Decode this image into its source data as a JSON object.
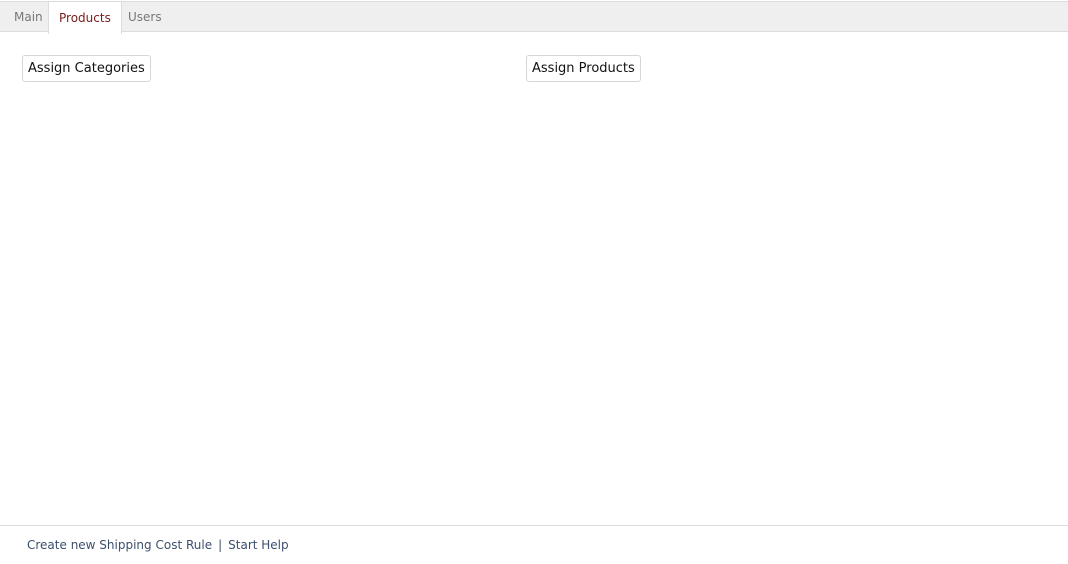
{
  "tabs": [
    {
      "label": "Main"
    },
    {
      "label": "Products"
    },
    {
      "label": "Users"
    }
  ],
  "active_tab": "Products",
  "content": {
    "assign_categories_label": "Assign Categories",
    "assign_products_label": "Assign Products"
  },
  "footer": {
    "create_rule_label": "Create new Shipping Cost Rule",
    "separator": "|",
    "start_help_label": "Start Help"
  },
  "colors": {
    "active_tab_text": "#7a1b1b",
    "link_text": "#3d4f6e"
  }
}
